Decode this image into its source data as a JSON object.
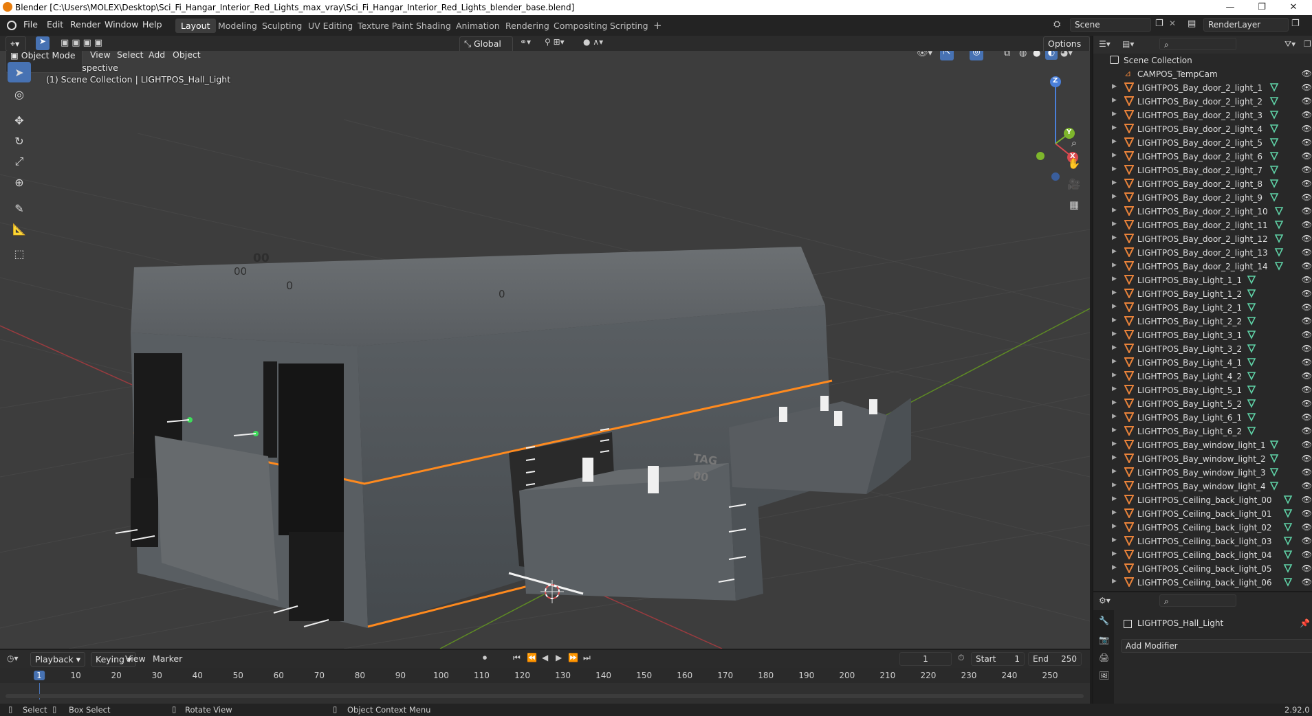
{
  "window": {
    "title": "Blender [C:\\Users\\MOLEX\\Desktop\\Sci_Fi_Hangar_Interior_Red_Lights_max_vray\\Sci_Fi_Hangar_Interior_Red_Lights_blender_base.blend]",
    "minimize": "—",
    "maximize": "❐",
    "close": "✕"
  },
  "menu": [
    "File",
    "Edit",
    "Render",
    "Window",
    "Help"
  ],
  "workspaces": [
    "Layout",
    "Modeling",
    "Sculpting",
    "UV Editing",
    "Texture Paint",
    "Shading",
    "Animation",
    "Rendering",
    "Compositing",
    "Scripting"
  ],
  "workspace_add": "+",
  "scene_field": "Scene",
  "renderlayer_field": "RenderLayer",
  "viewport_header": {
    "transform_orientation": "Global",
    "options": "Options",
    "mode": "Object Mode",
    "menus": [
      "View",
      "Select",
      "Add",
      "Object"
    ]
  },
  "viewport": {
    "perspective": "User Perspective",
    "collection_info": "(1) Scene Collection | LIGHTPOS_Hall_Light",
    "gizmo": {
      "x": "X",
      "y": "Y",
      "z": "Z"
    },
    "decals": [
      "00",
      "00",
      "0",
      "0"
    ],
    "crate_marks": [
      "TAG",
      "00"
    ]
  },
  "outliner": {
    "root": "Scene Collection",
    "items": [
      "CAMPOS_TempCam",
      "LIGHTPOS_Bay_door_2_light_1",
      "LIGHTPOS_Bay_door_2_light_2",
      "LIGHTPOS_Bay_door_2_light_3",
      "LIGHTPOS_Bay_door_2_light_4",
      "LIGHTPOS_Bay_door_2_light_5",
      "LIGHTPOS_Bay_door_2_light_6",
      "LIGHTPOS_Bay_door_2_light_7",
      "LIGHTPOS_Bay_door_2_light_8",
      "LIGHTPOS_Bay_door_2_light_9",
      "LIGHTPOS_Bay_door_2_light_10",
      "LIGHTPOS_Bay_door_2_light_11",
      "LIGHTPOS_Bay_door_2_light_12",
      "LIGHTPOS_Bay_door_2_light_13",
      "LIGHTPOS_Bay_door_2_light_14",
      "LIGHTPOS_Bay_Light_1_1",
      "LIGHTPOS_Bay_Light_1_2",
      "LIGHTPOS_Bay_Light_2_1",
      "LIGHTPOS_Bay_Light_2_2",
      "LIGHTPOS_Bay_Light_3_1",
      "LIGHTPOS_Bay_Light_3_2",
      "LIGHTPOS_Bay_Light_4_1",
      "LIGHTPOS_Bay_Light_4_2",
      "LIGHTPOS_Bay_Light_5_1",
      "LIGHTPOS_Bay_Light_5_2",
      "LIGHTPOS_Bay_Light_6_1",
      "LIGHTPOS_Bay_Light_6_2",
      "LIGHTPOS_Bay_window_light_1",
      "LIGHTPOS_Bay_window_light_2",
      "LIGHTPOS_Bay_window_light_3",
      "LIGHTPOS_Bay_window_light_4",
      "LIGHTPOS_Ceiling_back_light_00",
      "LIGHTPOS_Ceiling_back_light_01",
      "LIGHTPOS_Ceiling_back_light_02",
      "LIGHTPOS_Ceiling_back_light_03",
      "LIGHTPOS_Ceiling_back_light_04",
      "LIGHTPOS_Ceiling_back_light_05",
      "LIGHTPOS_Ceiling_back_light_06"
    ]
  },
  "properties": {
    "object_name": "LIGHTPOS_Hall_Light",
    "add_modifier": "Add Modifier"
  },
  "timeline": {
    "menus": [
      "Playback",
      "Keying",
      "View",
      "Marker"
    ],
    "current_frame": "1",
    "start_label": "Start",
    "start_value": "1",
    "end_label": "End",
    "end_value": "250",
    "ruler": [
      "1",
      "10",
      "20",
      "30",
      "40",
      "50",
      "60",
      "70",
      "80",
      "90",
      "100",
      "110",
      "120",
      "130",
      "140",
      "150",
      "160",
      "170",
      "180",
      "190",
      "200",
      "210",
      "220",
      "230",
      "240",
      "250"
    ]
  },
  "statusbar": {
    "select": "Select",
    "box_select": "Box Select",
    "rotate_view": "Rotate View",
    "context_menu": "Object Context Menu",
    "version": "2.92.0"
  },
  "colors": {
    "accent": "#4772b3",
    "light_icon": "#e8823a",
    "modifier_icon": "#5fd1a6",
    "x_axis": "#d9494f",
    "y_axis": "#7eb62c",
    "z_axis": "#4a7fd9",
    "orange_strip": "#ff8a1e"
  }
}
